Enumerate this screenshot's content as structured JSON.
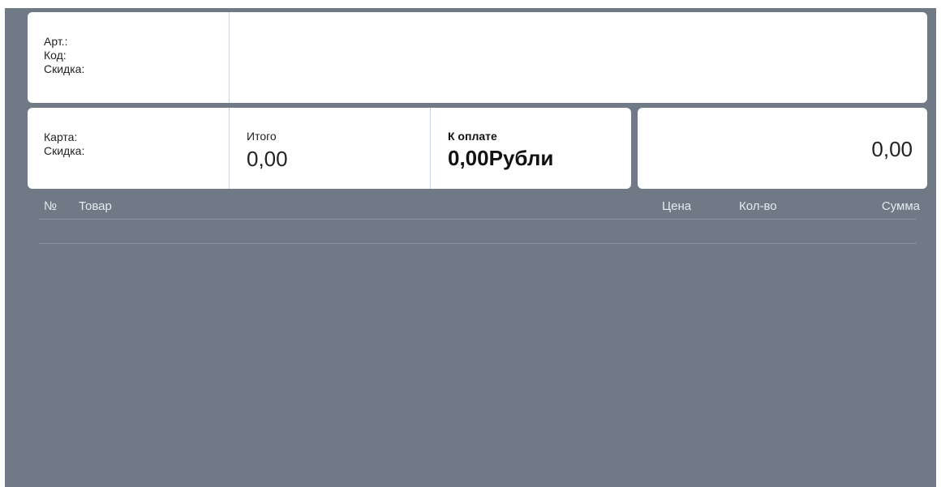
{
  "product_panel": {
    "art_label": "Арт.:",
    "code_label": "Код:",
    "discount_label": "Скидка:"
  },
  "totals_panel": {
    "card_label": "Карта:",
    "card_discount_label": "Скидка:",
    "total_label": "Итого",
    "total_value": "0,00",
    "to_pay_label": "К оплате",
    "to_pay_value": "0,00Рубли"
  },
  "amount_panel": {
    "value": "0,00"
  },
  "table": {
    "columns": {
      "number": "№",
      "product": "Товар",
      "price": "Цена",
      "quantity": "Кол-во",
      "sum": "Сумма"
    },
    "rows": []
  }
}
